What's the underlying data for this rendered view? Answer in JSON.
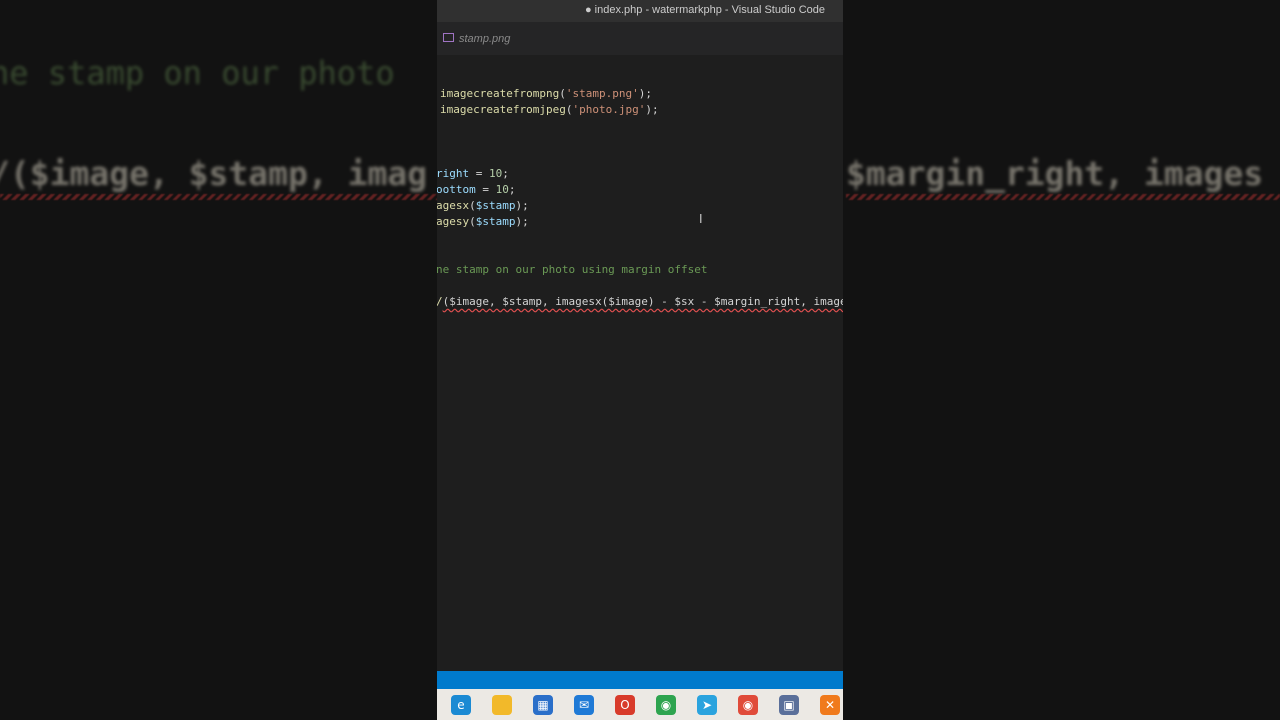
{
  "window": {
    "title": "● index.php - watermarkphp - Visual Studio Code"
  },
  "tabs": [
    {
      "label": "stamp.png",
      "icon": "image-file-icon"
    }
  ],
  "background": {
    "comment": "ne stamp on our photo",
    "call_left": "/($image, $stamp, imag",
    "call_right": "$margin_right, images"
  },
  "code": {
    "line1": {
      "fn": "imagecreatefrompng",
      "open": "(",
      "str": "'stamp.png'",
      "close": ");"
    },
    "line2": {
      "fn": "imagecreatefromjpeg",
      "open": "(",
      "str": "'photo.jpg'",
      "close": ");"
    },
    "line3": {
      "name": "right",
      "op": " = ",
      "num": "10",
      "end": ";"
    },
    "line4": {
      "name": "oottom",
      "op": " = ",
      "num": "10",
      "end": ";"
    },
    "line5": {
      "fn": "agesx",
      "open": "(",
      "var": "$stamp",
      "close": ");"
    },
    "line6": {
      "fn": "agesy",
      "open": "(",
      "var": "$stamp",
      "close": ");"
    },
    "line7": {
      "comment": "ne stamp on our photo using margin offset"
    },
    "line8": {
      "head": "/",
      "text": "($image, $stamp, imagesx($image) - $sx - $margin_right, images"
    }
  },
  "taskbar": {
    "apps": [
      {
        "name": "edge-icon",
        "color": "#1b8ad3",
        "glyph": "e"
      },
      {
        "name": "file-explorer-icon",
        "color": "#f2b92a",
        "glyph": ""
      },
      {
        "name": "store-icon",
        "color": "#2a6fc9",
        "glyph": "▦"
      },
      {
        "name": "mail-icon",
        "color": "#1f7ad6",
        "glyph": "✉"
      },
      {
        "name": "office-icon",
        "color": "#d83b2b",
        "glyph": "O"
      },
      {
        "name": "chrome-profile-icon",
        "color": "#2ea44f",
        "glyph": "◉"
      },
      {
        "name": "telegram-icon",
        "color": "#2aa3de",
        "glyph": "➤"
      },
      {
        "name": "chrome-icon",
        "color": "#e04b3a",
        "glyph": "◉"
      },
      {
        "name": "network-icon",
        "color": "#5a6f9a",
        "glyph": "▣"
      },
      {
        "name": "xampp-icon",
        "color": "#f07a1c",
        "glyph": "✕"
      }
    ]
  },
  "colors": {
    "editor_bg": "#1e1e1e",
    "status_bar": "#007acc",
    "taskbar": "#ece9e4"
  }
}
